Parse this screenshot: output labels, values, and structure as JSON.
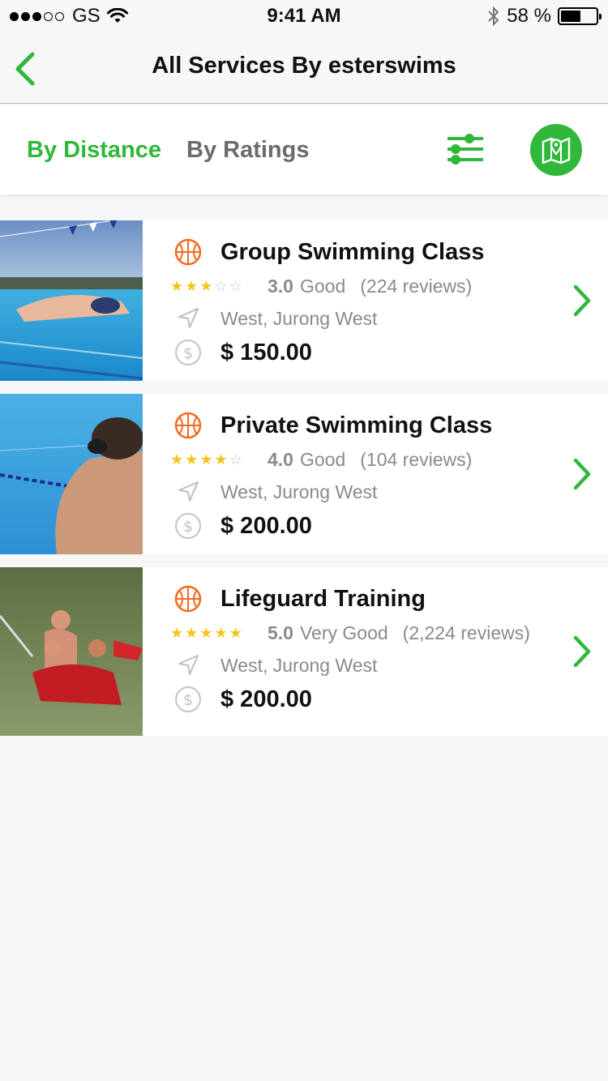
{
  "status_bar": {
    "carrier": "GS",
    "time": "9:41 AM",
    "battery": "58 %",
    "battery_level": 0.58
  },
  "nav": {
    "title": "All Services By esterswims"
  },
  "tabs": {
    "distance": "By Distance",
    "ratings": "By Ratings"
  },
  "colors": {
    "accent": "#2fb839",
    "sport_icon": "#f26a21",
    "star": "#f3c51a"
  },
  "services": [
    {
      "title": "Group Swimming Class",
      "stars": 3,
      "score": "3.0",
      "quality": "Good",
      "reviews": "(224 reviews)",
      "location": "West, Jurong West",
      "price": "$ 150.00"
    },
    {
      "title": "Private Swimming Class",
      "stars": 4,
      "score": "4.0",
      "quality": "Good",
      "reviews": "(104 reviews)",
      "location": "West, Jurong West",
      "price": "$ 200.00"
    },
    {
      "title": "Lifeguard Training",
      "stars": 5,
      "score": "5.0",
      "quality": "Very Good",
      "reviews": "(2,224 reviews)",
      "location": "West, Jurong West",
      "price": "$ 200.00"
    }
  ]
}
